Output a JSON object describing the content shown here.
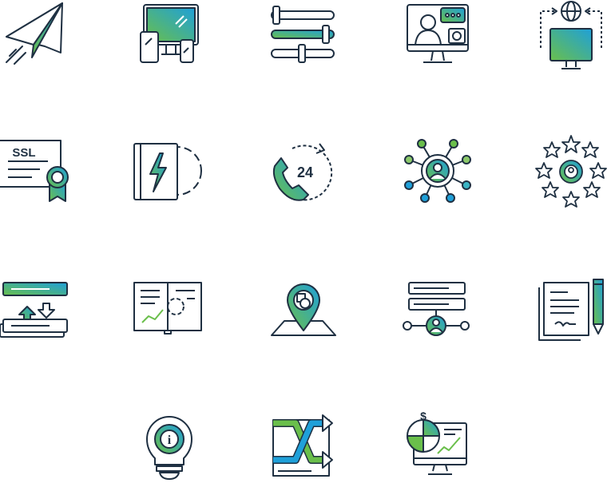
{
  "ssl_label": "SSL",
  "hours_label": "24",
  "info_label": "i",
  "currency_label": "$",
  "colors": {
    "stroke": "#1f3042",
    "green": "#6abf4b",
    "blue": "#1fa0d9",
    "white": "#ffffff"
  },
  "icons": [
    "paper-plane-icon",
    "devices-icon",
    "sliders-icon",
    "video-chat-icon",
    "global-monitor-icon",
    "ssl-certificate-icon",
    "book-gear-icon",
    "phone-24-icon",
    "user-network-icon",
    "user-stars-icon",
    "data-transfer-icon",
    "manual-chart-icon",
    "map-pin-icon",
    "server-user-icon",
    "contract-pencil-icon",
    "lightbulb-info-icon",
    "shuffle-icon",
    "monitor-analytics-icon"
  ]
}
